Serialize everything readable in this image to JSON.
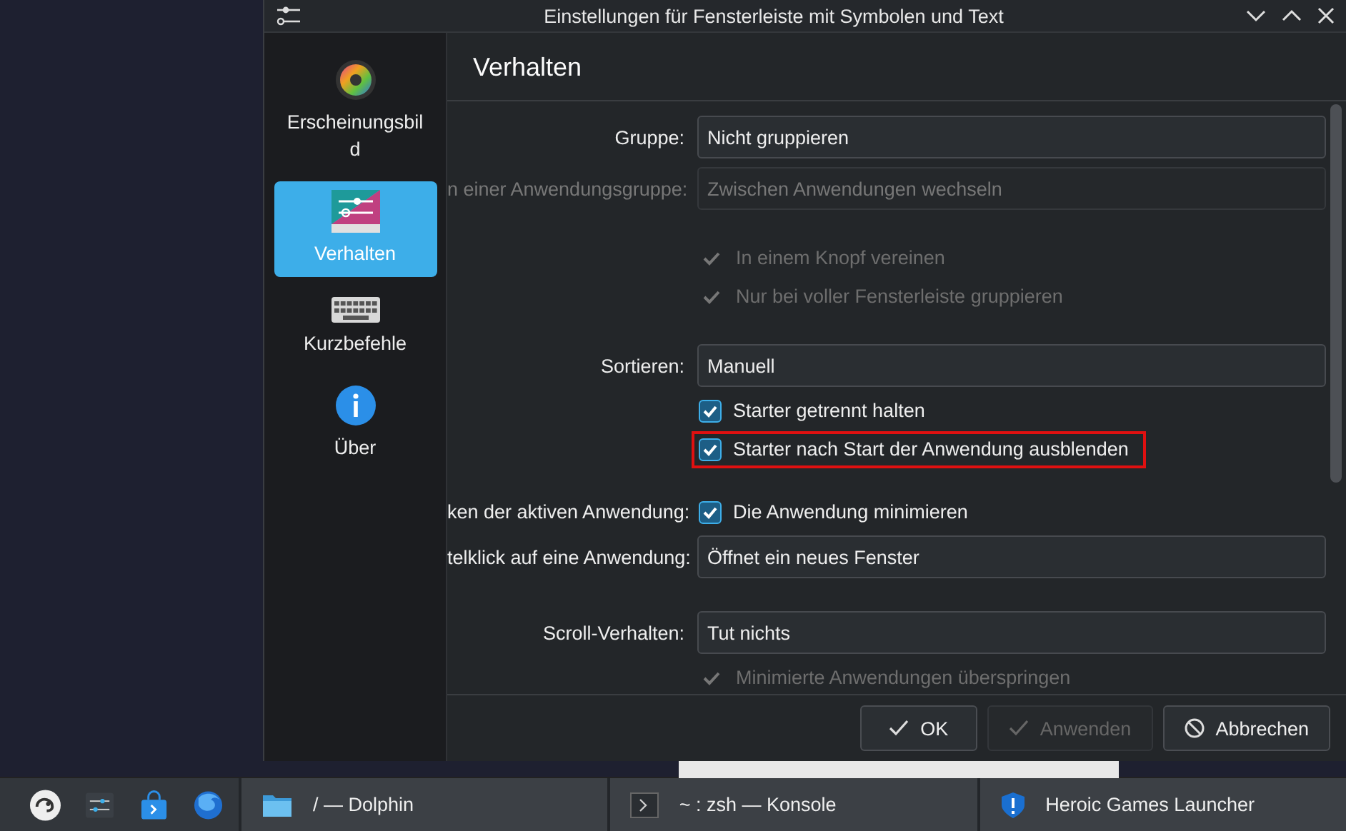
{
  "window": {
    "title": "Einstellungen für Fensterleiste mit Symbolen und Text"
  },
  "sidebar": {
    "items": [
      {
        "label": "Erscheinungsbild",
        "kind": "appearance",
        "selected": false
      },
      {
        "label": "Verhalten",
        "kind": "behavior",
        "selected": true
      },
      {
        "label": "Kurzbefehle",
        "kind": "shortcuts",
        "selected": false
      },
      {
        "label": "Über",
        "kind": "about",
        "selected": false
      }
    ]
  },
  "page": {
    "title": "Verhalten",
    "sections": [
      {
        "rows": [
          {
            "kind": "combo",
            "label": "Gruppe:",
            "value": "Nicht gruppieren",
            "disabled": false
          },
          {
            "kind": "combo",
            "label": "n einer Anwendungsgruppe:",
            "value": "Zwischen Anwendungen wechseln",
            "disabled": true
          }
        ]
      },
      {
        "rows": [
          {
            "kind": "check",
            "text": "In einem Knopf vereinen",
            "checked": true,
            "disabled": true,
            "highlighted": false
          },
          {
            "kind": "check",
            "text": "Nur bei voller Fensterleiste gruppieren",
            "checked": true,
            "disabled": true,
            "highlighted": false
          }
        ]
      },
      {
        "rows": [
          {
            "kind": "combo",
            "label": "Sortieren:",
            "value": "Manuell",
            "disabled": false
          },
          {
            "kind": "check",
            "text": "Starter getrennt halten",
            "checked": true,
            "disabled": false,
            "highlighted": false
          },
          {
            "kind": "check",
            "text": "Starter nach Start der Anwendung ausblenden",
            "checked": true,
            "disabled": false,
            "highlighted": true
          }
        ]
      },
      {
        "rows": [
          {
            "kind": "check",
            "label": "ken der aktiven Anwendung:",
            "text": "Die Anwendung minimieren",
            "checked": true,
            "disabled": false,
            "highlighted": false
          },
          {
            "kind": "combo",
            "label": "telklick auf eine Anwendung:",
            "value": "Öffnet ein neues Fenster",
            "disabled": false
          }
        ]
      },
      {
        "rows": [
          {
            "kind": "combo",
            "label": "Scroll-Verhalten:",
            "value": "Tut nichts",
            "disabled": false
          },
          {
            "kind": "check",
            "text": "Minimierte Anwendungen überspringen",
            "checked": true,
            "disabled": true,
            "highlighted": false
          }
        ]
      }
    ]
  },
  "buttons": [
    {
      "label": "OK",
      "kind": "ok",
      "disabled": false
    },
    {
      "label": "Anwenden",
      "kind": "apply",
      "disabled": true
    },
    {
      "label": "Abbrechen",
      "kind": "cancel",
      "disabled": false
    }
  ],
  "taskbar": {
    "tasks": [
      {
        "label": "/ — Dolphin",
        "kind": "folder"
      },
      {
        "label": "~ : zsh — Konsole",
        "kind": "terminal"
      },
      {
        "label": "Heroic Games Launcher",
        "kind": "shield"
      }
    ]
  }
}
